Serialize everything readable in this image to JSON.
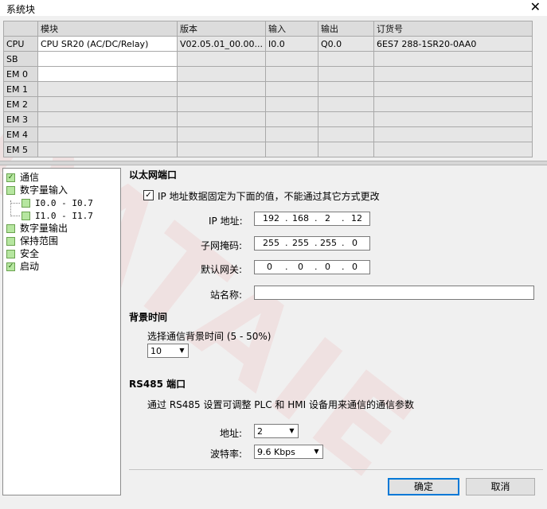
{
  "window": {
    "title": "系统块"
  },
  "module_table": {
    "headers": [
      "",
      "模块",
      "版本",
      "输入",
      "输出",
      "订货号"
    ],
    "rows": [
      [
        "CPU",
        "CPU SR20 (AC/DC/Relay)",
        "V02.05.01_00.00...",
        "I0.0",
        "Q0.0",
        "6ES7 288-1SR20-0AA0"
      ],
      [
        "SB",
        "",
        "",
        "",
        "",
        ""
      ],
      [
        "EM 0",
        "",
        "",
        "",
        "",
        ""
      ],
      [
        "EM 1",
        "",
        "",
        "",
        "",
        ""
      ],
      [
        "EM 2",
        "",
        "",
        "",
        "",
        ""
      ],
      [
        "EM 3",
        "",
        "",
        "",
        "",
        ""
      ],
      [
        "EM 4",
        "",
        "",
        "",
        "",
        ""
      ],
      [
        "EM 5",
        "",
        "",
        "",
        "",
        ""
      ]
    ]
  },
  "tree": {
    "items": [
      {
        "label": "通信",
        "checked": true
      },
      {
        "label": "数字量输入",
        "checked": false
      },
      {
        "label": "I0.0 - I0.7",
        "checked": false
      },
      {
        "label": "I1.0 - I1.7",
        "checked": false
      },
      {
        "label": "数字量输出",
        "checked": false
      },
      {
        "label": "保持范围",
        "checked": false
      },
      {
        "label": "安全",
        "checked": false
      },
      {
        "label": "启动",
        "checked": true
      }
    ]
  },
  "ethernet": {
    "title": "以太网端口",
    "fixed_ip_label": "IP 地址数据固定为下面的值，不能通过其它方式更改",
    "fixed_ip_checked": "✓",
    "ip_label": "IP 地址:",
    "ip": [
      "192",
      "168",
      "2",
      "12"
    ],
    "subnet_label": "子网掩码:",
    "subnet": [
      "255",
      "255",
      "255",
      "0"
    ],
    "gateway_label": "默认网关:",
    "gateway": [
      "0",
      "0",
      "0",
      "0"
    ],
    "station_label": "站名称:",
    "station_value": ""
  },
  "background_time": {
    "title": "背景时间",
    "select_label": "选择通信背景时间 (5 - 50%)",
    "value": "10"
  },
  "rs485": {
    "title": "RS485 端口",
    "description": "通过 RS485 设置可调整 PLC 和 HMI 设备用来通信的通信参数",
    "address_label": "地址:",
    "address_value": "2",
    "baud_label": "波特率:",
    "baud_value": "9.6 Kbps"
  },
  "buttons": {
    "ok": "确定",
    "cancel": "取消"
  },
  "icons": {
    "close": "close-icon",
    "dropdown": "chevron-down-icon",
    "check": "checkmark-icon"
  }
}
